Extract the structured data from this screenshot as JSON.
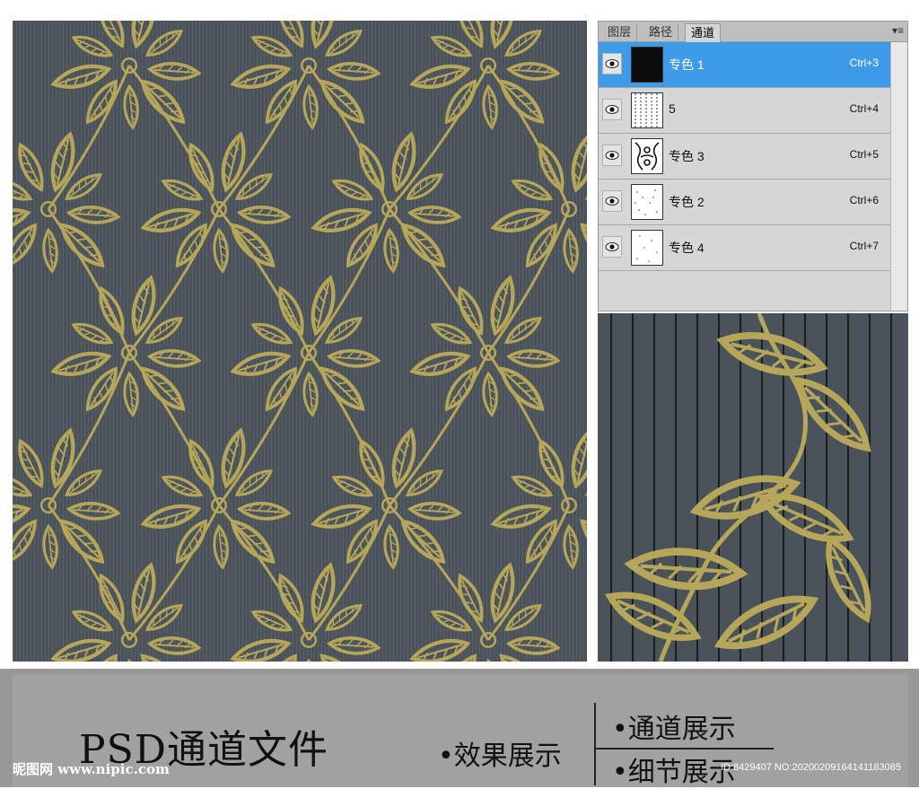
{
  "channels_panel": {
    "tabs": [
      {
        "label": "图层",
        "active": false
      },
      {
        "label": "路径",
        "active": false
      },
      {
        "label": "通道",
        "active": true
      }
    ],
    "menu_icon": "panel-menu-icon",
    "channels": [
      {
        "name": "专色 1",
        "shortcut": "Ctrl+3",
        "selected": true,
        "thumb": "solid-black"
      },
      {
        "name": "5",
        "shortcut": "Ctrl+4",
        "selected": false,
        "thumb": "stripes"
      },
      {
        "name": "专色 3",
        "shortcut": "Ctrl+5",
        "selected": false,
        "thumb": "dense-pattern"
      },
      {
        "name": "专色 2",
        "shortcut": "Ctrl+6",
        "selected": false,
        "thumb": "sparse-pattern"
      },
      {
        "name": "专色 4",
        "shortcut": "Ctrl+7",
        "selected": false,
        "thumb": "sparse-pattern"
      }
    ],
    "selected_color": "#3d9be9"
  },
  "pattern": {
    "background_color": "#4a525a",
    "motif_color": "#b5a65a",
    "motif_outline": "#1f2428"
  },
  "footer": {
    "title": "PSD通道文件",
    "items": [
      "•效果展示",
      "•通道展示",
      "•细节展示"
    ],
    "watermark": "昵图网 www.nipic.com",
    "image_id": "ID:8429407 NO:20200209164141183085"
  }
}
